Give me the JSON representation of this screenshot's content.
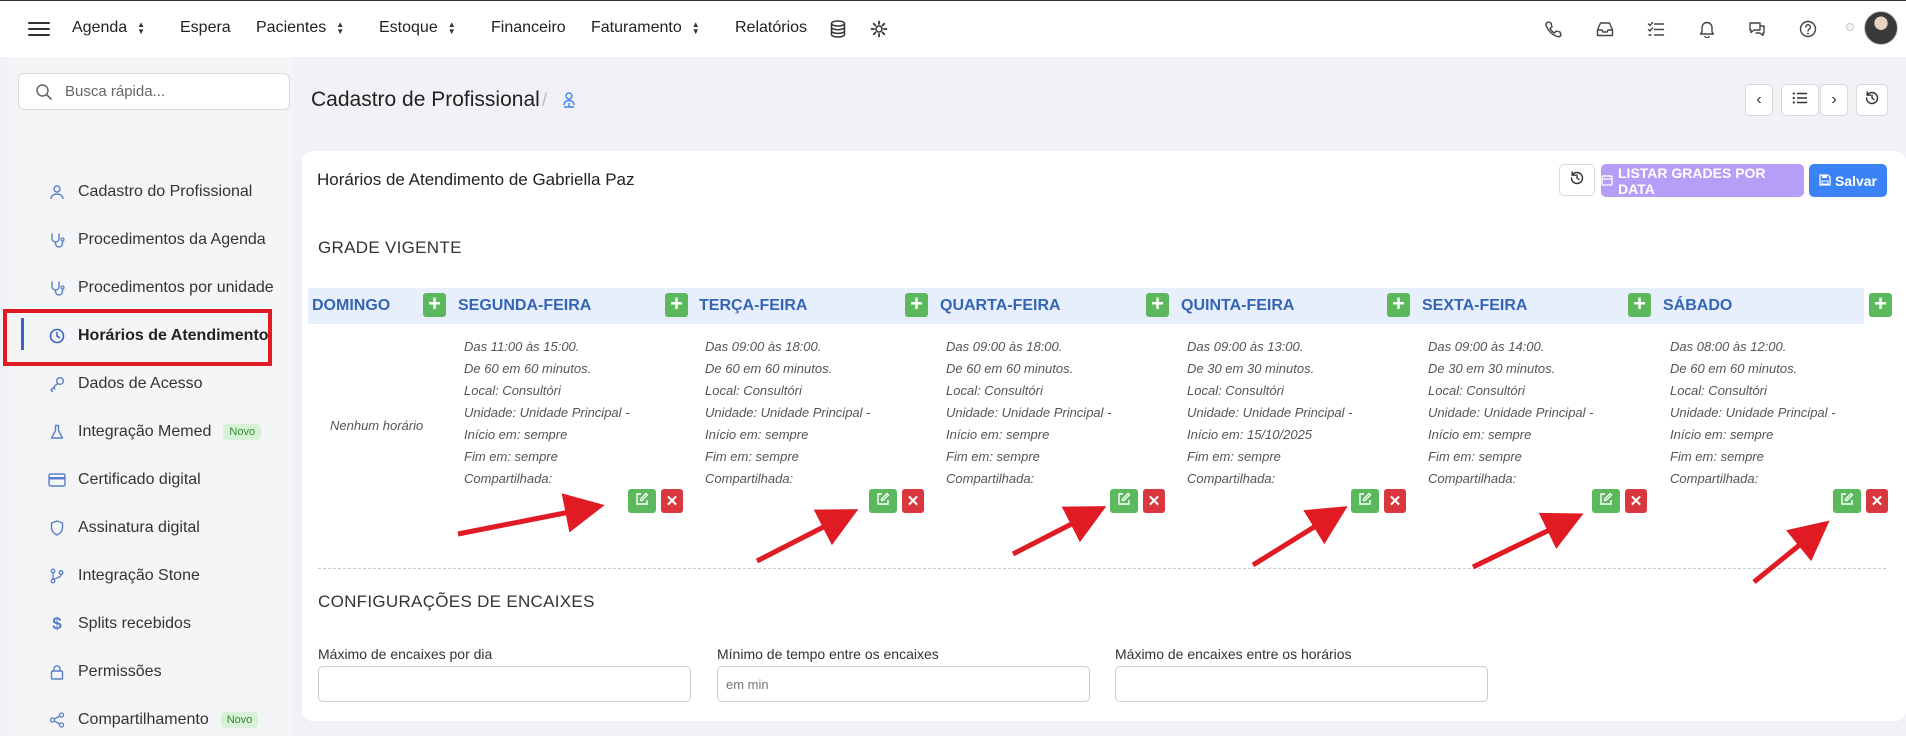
{
  "nav": {
    "items": [
      {
        "label": "Agenda",
        "has_toggle": true
      },
      {
        "label": "Espera",
        "has_toggle": false
      },
      {
        "label": "Pacientes",
        "has_toggle": true
      },
      {
        "label": "Estoque",
        "has_toggle": true
      },
      {
        "label": "Financeiro",
        "has_toggle": false
      },
      {
        "label": "Faturamento",
        "has_toggle": true
      },
      {
        "label": "Relatórios",
        "has_toggle": false
      }
    ],
    "right_icons": [
      "phone-icon",
      "inbox-icon",
      "checklist-icon",
      "bell-icon",
      "chat-icon",
      "help-icon"
    ]
  },
  "search": {
    "placeholder": "Busca rápida..."
  },
  "sidebar": {
    "items": [
      {
        "label": "Cadastro do Profissional",
        "icon": "user-icon"
      },
      {
        "label": "Procedimentos da Agenda",
        "icon": "stethoscope-icon"
      },
      {
        "label": "Procedimentos por unidade",
        "icon": "stethoscope-icon"
      },
      {
        "label": "Horários de Atendimento",
        "icon": "clock-icon",
        "active": true
      },
      {
        "label": "Dados de Acesso",
        "icon": "key-icon"
      },
      {
        "label": "Integração Memed",
        "icon": "flask-icon",
        "badge": "Novo"
      },
      {
        "label": "Certificado digital",
        "icon": "card-icon"
      },
      {
        "label": "Assinatura digital",
        "icon": "shield-icon"
      },
      {
        "label": "Integração Stone",
        "icon": "git-branch-icon"
      },
      {
        "label": "Splits recebidos",
        "icon": "dollar-icon"
      },
      {
        "label": "Permissões",
        "icon": "lock-icon"
      },
      {
        "label": "Compartilhamento",
        "icon": "share-icon",
        "badge": "Novo"
      }
    ]
  },
  "page": {
    "title": "Cadastro de Profissional",
    "separator": "/"
  },
  "card": {
    "title": "Horários de Atendimento de Gabriella Paz",
    "listar_label": "LISTAR GRADES POR DATA",
    "salvar_label": "Salvar"
  },
  "grade": {
    "title": "GRADE VIGENTE",
    "no_schedule": "Nenhum horário",
    "days": [
      {
        "label": "DOMINGO",
        "schedule": null
      },
      {
        "label": "SEGUNDA-FEIRA",
        "schedule": [
          "Das 11:00 às 15:00.",
          "De 60 em 60 minutos.",
          "Local: Consultóri",
          "Unidade: Unidade Principal -",
          "Início em: sempre",
          "Fim em: sempre",
          "Compartilhada:"
        ]
      },
      {
        "label": "TERÇA-FEIRA",
        "schedule": [
          "Das 09:00 às 18:00.",
          "De 60 em 60 minutos.",
          "Local: Consultóri",
          "Unidade: Unidade Principal -",
          "Início em: sempre",
          "Fim em: sempre",
          "Compartilhada:"
        ]
      },
      {
        "label": "QUARTA-FEIRA",
        "schedule": [
          "Das 09:00 às 18:00.",
          "De 60 em 60 minutos.",
          "Local: Consultóri",
          "Unidade: Unidade Principal -",
          "Início em: sempre",
          "Fim em: sempre",
          "Compartilhada:"
        ]
      },
      {
        "label": "QUINTA-FEIRA",
        "schedule": [
          "Das 09:00 às 13:00.",
          "De 30 em 30 minutos.",
          "Local: Consultóri",
          "Unidade: Unidade Principal -",
          "Início em: 15/10/2025",
          "Fim em: sempre",
          "Compartilhada:"
        ]
      },
      {
        "label": "SEXTA-FEIRA",
        "schedule": [
          "Das 09:00 às 14:00.",
          "De 30 em 30 minutos.",
          "Local: Consultóri",
          "Unidade: Unidade Principal -",
          "Início em: sempre",
          "Fim em: sempre",
          "Compartilhada:"
        ]
      },
      {
        "label": "SÁBADO",
        "schedule": [
          "Das 08:00 às 12:00.",
          "De 60 em 60 minutos.",
          "Local: Consultóri",
          "Unidade: Unidade Principal -",
          "Início em: sempre",
          "Fim em: sempre",
          "Compartilhada:"
        ]
      }
    ]
  },
  "encaixes": {
    "title": "CONFIGURAÇÕES DE ENCAIXES",
    "fields": [
      {
        "label": "Máximo de encaixes por dia",
        "placeholder": "",
        "value": ""
      },
      {
        "label": "Mínimo de tempo entre os encaixes",
        "placeholder": "em min",
        "value": ""
      },
      {
        "label": "Máximo de encaixes entre os horários",
        "placeholder": "",
        "value": ""
      }
    ]
  },
  "colors": {
    "accent": "#3b82f6",
    "purple": "#b59ef7",
    "green": "#5cb85c",
    "red": "#d9363e",
    "annotation": "#e01b24",
    "header_bg": "#e8effc",
    "day_text": "#3565b5"
  }
}
